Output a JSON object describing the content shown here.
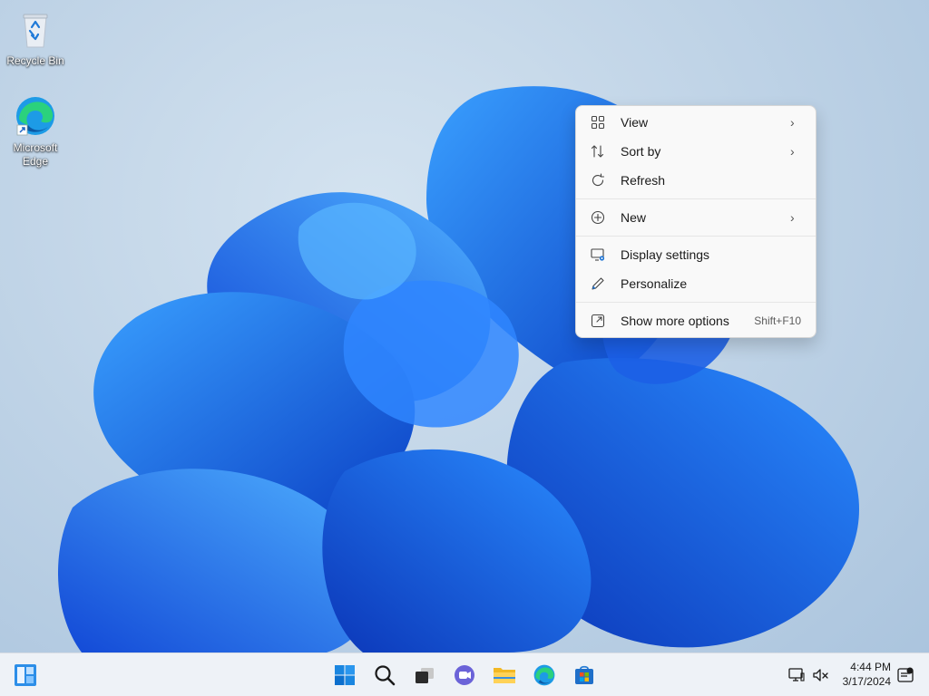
{
  "desktop": {
    "icons": [
      {
        "label": "Recycle Bin",
        "icon": "recycle-bin-icon"
      },
      {
        "label": "Microsoft Edge",
        "icon": "edge-icon"
      }
    ]
  },
  "context_menu": {
    "items": [
      {
        "label": "View",
        "icon": "grid-view-icon",
        "submenu": true
      },
      {
        "label": "Sort by",
        "icon": "sort-icon",
        "submenu": true
      },
      {
        "label": "Refresh",
        "icon": "refresh-icon"
      },
      {
        "label": "New",
        "icon": "plus-circle-icon",
        "submenu": true
      },
      {
        "label": "Display settings",
        "icon": "display-settings-icon"
      },
      {
        "label": "Personalize",
        "icon": "pen-icon"
      },
      {
        "label": "Show more options",
        "icon": "more-options-icon",
        "shortcut": "Shift+F10"
      }
    ]
  },
  "taskbar": {
    "apps": [
      "start-icon",
      "search-icon",
      "task-view-icon",
      "chat-icon",
      "file-explorer-icon",
      "edge-icon",
      "store-icon"
    ],
    "clock": {
      "time": "4:44 PM",
      "date": "3/17/2024"
    }
  },
  "colors": {
    "accent": "#0078d4",
    "menu_bg": "#f9f9f9",
    "taskbar_bg": "#eef2f7"
  }
}
